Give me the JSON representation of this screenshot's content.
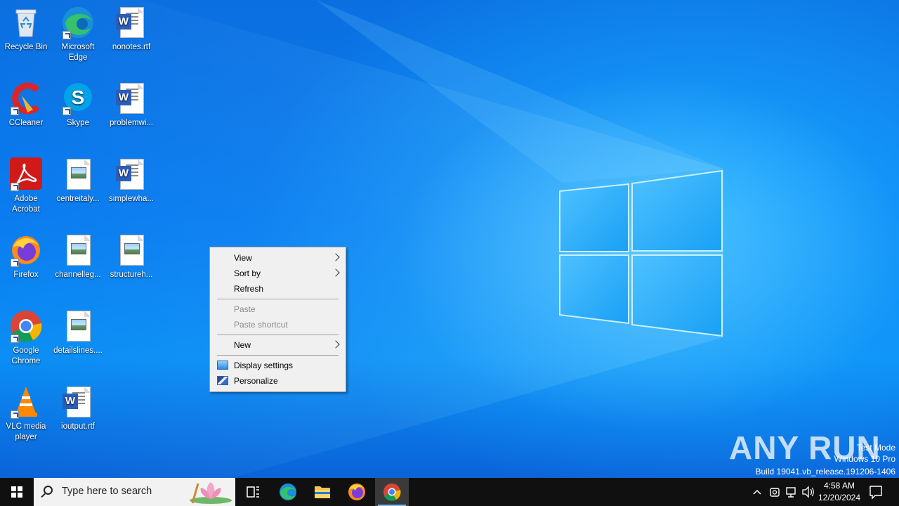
{
  "desktop": {
    "icons": [
      {
        "label": "Recycle Bin"
      },
      {
        "label": "Microsoft Edge"
      },
      {
        "label": "nonotes.rtf"
      },
      {
        "label": "CCleaner"
      },
      {
        "label": "Skype"
      },
      {
        "label": "problemwi..."
      },
      {
        "label": "Adobe Acrobat"
      },
      {
        "label": "centreitaly..."
      },
      {
        "label": "simplewha..."
      },
      {
        "label": "Firefox"
      },
      {
        "label": "channelleg..."
      },
      {
        "label": "structureh..."
      },
      {
        "label": "Google Chrome"
      },
      {
        "label": "detailslines...."
      },
      {
        "label": "VLC media player"
      },
      {
        "label": "ioutput.rtf"
      }
    ]
  },
  "context_menu": {
    "view": "View",
    "sort_by": "Sort by",
    "refresh": "Refresh",
    "paste": "Paste",
    "paste_shortcut": "Paste shortcut",
    "new": "New",
    "display_settings": "Display settings",
    "personalize": "Personalize"
  },
  "watermark": {
    "brand": "ANY RUN",
    "line1": "Test Mode",
    "line2": "Windows 10 Pro",
    "line3": "Build 19041.vb_release.191206-1406"
  },
  "taskbar": {
    "search_placeholder": "Type here to search",
    "time": "4:58 AM",
    "date": "12/20/2024"
  },
  "colors": {
    "taskbar": "#101010",
    "menu_bg": "#f0f0f0",
    "accent": "#76b9ed"
  }
}
